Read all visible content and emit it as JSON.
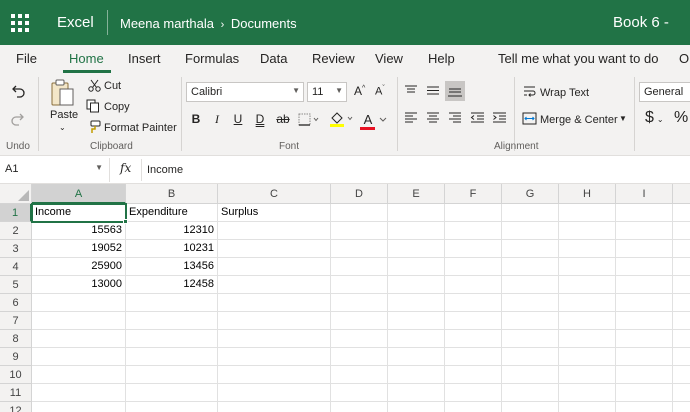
{
  "titlebar": {
    "app": "Excel",
    "user": "Meena marthala",
    "breadcrumb_sep": "›",
    "folder": "Documents",
    "book": "Book 6  -"
  },
  "tabs": [
    "File",
    "Home",
    "Insert",
    "Formulas",
    "Data",
    "Review",
    "View",
    "Help",
    "Tell me what you want to do",
    "O"
  ],
  "active_tab": "Home",
  "ribbon": {
    "undo_label": "Undo",
    "paste_label": "Paste",
    "cut_label": "Cut",
    "copy_label": "Copy",
    "format_painter_label": "Format Painter",
    "clipboard_label": "Clipboard",
    "font_name": "Calibri",
    "font_size": "11",
    "grow_font": "A",
    "shrink_font": "A",
    "bold": "B",
    "italic": "I",
    "underline": "U",
    "double_underline": "D",
    "strike": "ab",
    "font_label": "Font",
    "wrap_text_label": "Wrap Text",
    "merge_label": "Merge & Center",
    "alignment_label": "Alignment",
    "number_format": "General",
    "currency": "$",
    "percent": "%"
  },
  "formula_bar": {
    "name_box": "A1",
    "fx": "fx",
    "formula": "Income"
  },
  "sheet": {
    "columns": [
      "A",
      "B",
      "C",
      "D",
      "E",
      "F",
      "G",
      "H",
      "I"
    ],
    "rows": [
      "1",
      "2",
      "3",
      "4",
      "5",
      "6",
      "7",
      "8",
      "9",
      "10",
      "11",
      "12"
    ],
    "headers": [
      "Income",
      "Expenditure",
      "Surplus"
    ],
    "data": [
      [
        "15563",
        "12310"
      ],
      [
        "19052",
        "10231"
      ],
      [
        "25900",
        "13456"
      ],
      [
        "13000",
        "12458"
      ]
    ],
    "selected_cell": "A1"
  },
  "colors": {
    "brand": "#217346",
    "ribbon_bg": "#f3f2f1",
    "font_color_bar": "#e81123",
    "highlight_bar": "#ffff00"
  }
}
